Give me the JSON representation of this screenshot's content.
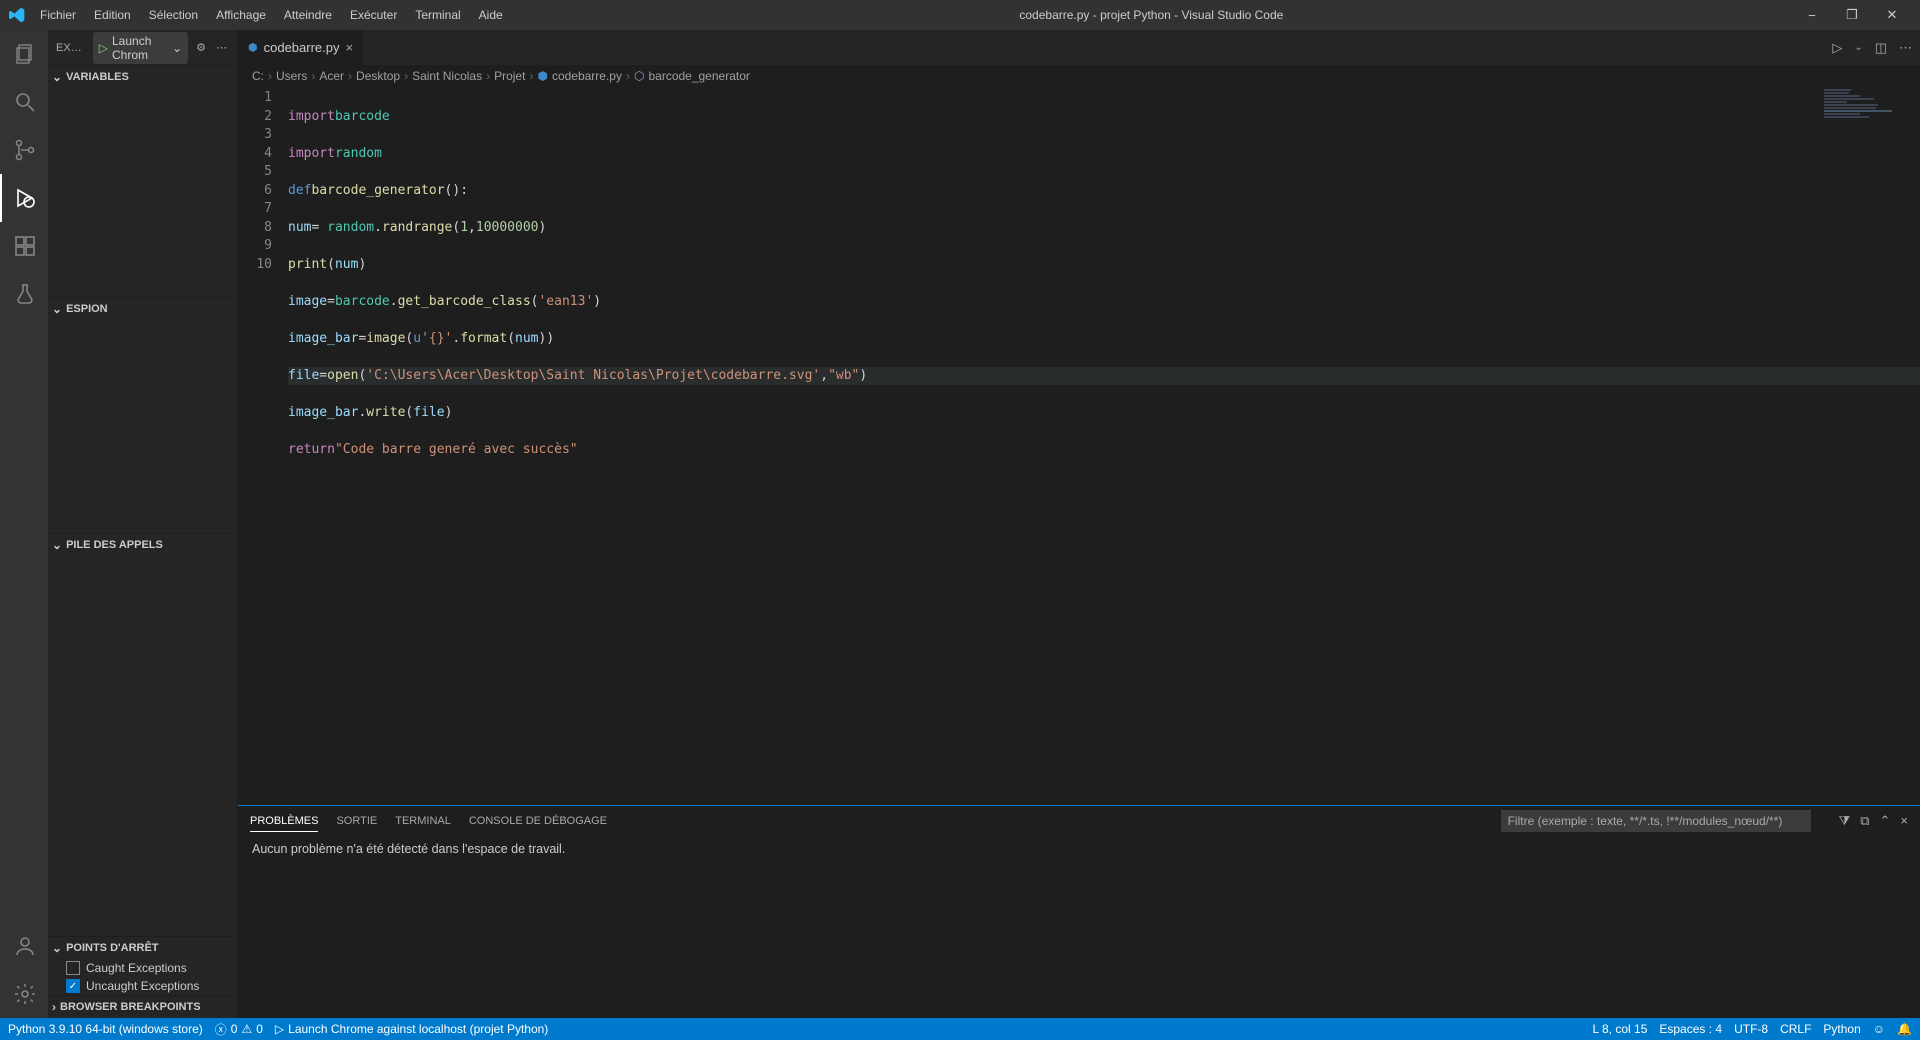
{
  "titlebar": {
    "menu": [
      "Fichier",
      "Edition",
      "Sélection",
      "Affichage",
      "Atteindre",
      "Exécuter",
      "Terminal",
      "Aide"
    ],
    "title": "codebarre.py - projet Python - Visual Studio Code"
  },
  "activitybar": {
    "items": [
      "files-icon",
      "search-icon",
      "source-control-icon",
      "run-debug-icon",
      "extensions-icon",
      "testing-icon"
    ],
    "bottom": [
      "account-icon",
      "settings-gear-icon"
    ],
    "active_index": 3
  },
  "sidebar": {
    "header_label": "EXÉC...",
    "launch_label": "Launch Chrom",
    "sections": {
      "variables": "VARIABLES",
      "espion": "ESPION",
      "pile": "PILE DES APPELS",
      "points_arret": "POINTS D'ARRÊT",
      "browser_bp": "BROWSER BREAKPOINTS"
    },
    "breakpoints": [
      {
        "label": "Caught Exceptions",
        "checked": false
      },
      {
        "label": "Uncaught Exceptions",
        "checked": true
      }
    ]
  },
  "tabs": [
    {
      "name": "codebarre.py"
    }
  ],
  "breadcrumb": [
    "C:",
    "Users",
    "Acer",
    "Desktop",
    "Saint Nicolas",
    "Projet",
    "codebarre.py",
    "barcode_generator"
  ],
  "code_lines": [
    "1",
    "2",
    "3",
    "4",
    "5",
    "6",
    "7",
    "8",
    "9",
    "10"
  ],
  "code": {
    "l1_kw": "import",
    "l1_mod": "barcode",
    "l2_kw": "import",
    "l2_mod": "random",
    "l3_def": "def",
    "l3_fn": "barcode_generator",
    "l3_p": "():",
    "l4_id": "num",
    "l4_eq": "= ",
    "l4_mod": "random",
    "l4_dot": ".",
    "l4_fn": "randrange",
    "l4_open": "(",
    "l4_n1": "1",
    "l4_c": ",",
    "l4_n2": "10000000",
    "l4_close": ")",
    "l5_fn": "print",
    "l5_open": "(",
    "l5_id": "num",
    "l5_close": ")",
    "l6_id": "image",
    "l6_eq": "=",
    "l6_mod": "barcode",
    "l6_dot": ".",
    "l6_fn": "get_barcode_class",
    "l6_open": "(",
    "l6_str": "'ean13'",
    "l6_close": ")",
    "l7_id1": "image_bar",
    "l7_eq": "=",
    "l7_fn": "image",
    "l7_open": "(",
    "l7_pre": "u",
    "l7_str": "'{}'",
    "l7_dot": ".",
    "l7_fn2": "format",
    "l7_open2": "(",
    "l7_id2": "num",
    "l7_close": "))",
    "l8_id": "file",
    "l8_eq": "=",
    "l8_fn": "open",
    "l8_open": "(",
    "l8_str1": "'C:\\Users\\Acer\\Desktop\\Saint Nicolas\\Projet\\codebarre.svg'",
    "l8_c": ",",
    "l8_str2": "\"wb\"",
    "l8_close": ")",
    "l9_id": "image_bar",
    "l9_dot": ".",
    "l9_fn": "write",
    "l9_open": "(",
    "l9_arg": "file",
    "l9_close": ")",
    "l10_ret": "return",
    "l10_str": "\"Code barre generé avec succès\""
  },
  "bottom_panel": {
    "tabs": [
      "PROBLÈMES",
      "SORTIE",
      "TERMINAL",
      "CONSOLE DE DÉBOGAGE"
    ],
    "filter_placeholder": "Filtre (exemple : texte, **/*.ts, !**/modules_nœud/**)",
    "message": "Aucun problème n'a été détecté dans l'espace de travail."
  },
  "statusbar": {
    "python": "Python 3.9.10 64-bit (windows store)",
    "errors": "0",
    "warnings": "0",
    "launch": "Launch Chrome against localhost (projet Python)",
    "pos": "L 8, col 15",
    "spaces": "Espaces : 4",
    "encoding": "UTF-8",
    "eol": "CRLF",
    "lang": "Python"
  }
}
